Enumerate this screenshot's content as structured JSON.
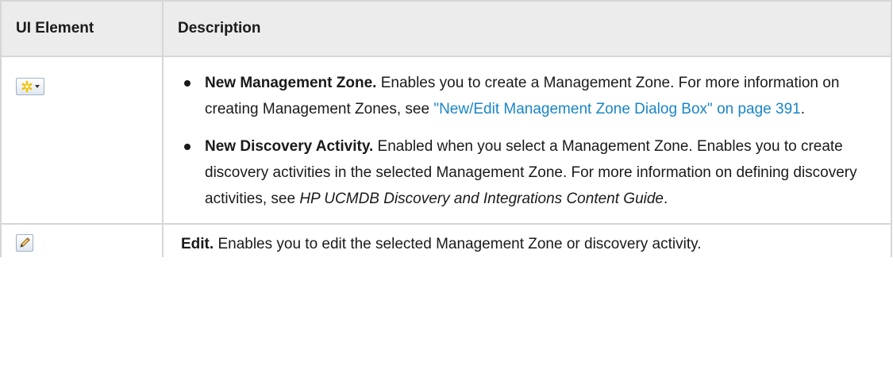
{
  "table": {
    "headers": {
      "element": "UI Element",
      "description": "Description"
    },
    "rows": [
      {
        "icon": "new-asterisk-dropdown-icon",
        "bullets": [
          {
            "title": "New Management Zone.",
            "text1": " Enables you to create a Management Zone. For more information on creating Management Zones, see ",
            "link": "\"New/Edit Management Zone Dialog Box\" on page 391",
            "text2": "."
          },
          {
            "title": "New Discovery Activity.",
            "text1": " Enabled when you select a Management Zone. Enables you to create discovery activities in the selected Management Zone. For more information on defining discovery activities, see ",
            "italic": "HP UCMDB Discovery and Integrations Content Guide",
            "text2": "."
          }
        ]
      },
      {
        "icon": "pencil-edit-icon",
        "title": "Edit.",
        "text": " Enables you to edit the selected Management Zone or discovery activity."
      }
    ]
  },
  "colors": {
    "link": "#1a85c7",
    "header_bg": "#ececec",
    "border": "#d6d6d6",
    "icon_star": "#f2c200"
  }
}
